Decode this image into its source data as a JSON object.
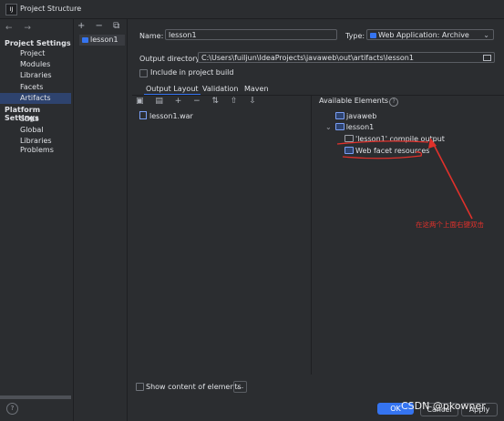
{
  "window": {
    "title": "Project Structure",
    "logo": "IJ"
  },
  "sidebar": {
    "nav_arrows": "← →",
    "project_settings_label": "Project Settings",
    "project_items": [
      "Project",
      "Modules",
      "Libraries",
      "Facets",
      "Artifacts"
    ],
    "active_item": "Artifacts",
    "platform_settings_label": "Platform Settings",
    "platform_items": [
      "SDKs",
      "Global Libraries"
    ],
    "problems_label": "Problems"
  },
  "artifacts_list": {
    "tools": "+ − ⧉",
    "items": [
      "lesson1"
    ]
  },
  "form": {
    "name_label": "Name:",
    "name_value": "lesson1",
    "type_label": "Type:",
    "type_value": "Web Application: Archive",
    "output_dir_label": "Output directory:",
    "output_dir_value": "C:\\Users\\fuiljun\\IdeaProjects\\javaweb\\out\\artifacts\\lesson1",
    "include_label": "Include in project build"
  },
  "tabs": [
    "Output Layout",
    "Validation",
    "Maven"
  ],
  "layout_panel": {
    "tools": "▣ ▤ + − ⇅ ⇧ ⇩",
    "root_item": "lesson1.war"
  },
  "available": {
    "title": "Available Elements",
    "help": "?",
    "javaweb": "javaweb",
    "module": "lesson1",
    "compile_output": "'lesson1' compile output",
    "facet_resources": "Web facet resources",
    "expand_glyph": "⌄"
  },
  "annotation": "在这两个上面右键双击",
  "bottom": {
    "show_content_label": "Show content of elements",
    "dots": "...",
    "ok": "OK",
    "cancel": "Cancel",
    "apply": "Apply",
    "help": "?"
  },
  "watermark": "CSDN @pkowner",
  "colors": {
    "accent": "#3574f0",
    "annotation": "#e0312b",
    "selection": "#2e436e"
  }
}
